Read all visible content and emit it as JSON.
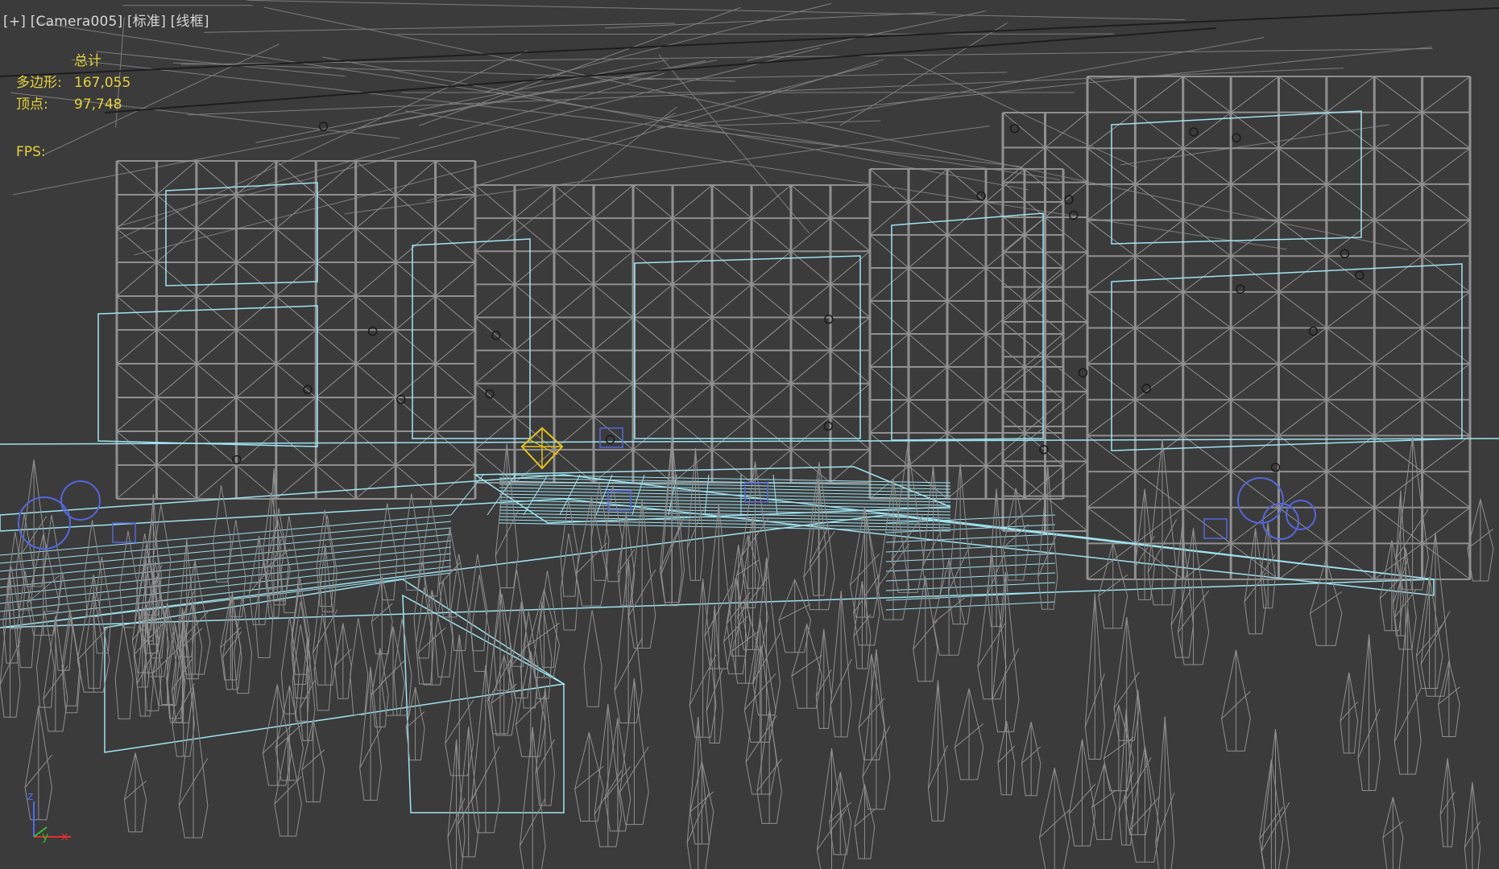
{
  "viewport_label": {
    "menu": "[+]",
    "camera": "[Camera005]",
    "shading": "[标准]",
    "mode": "[线框]"
  },
  "stats": {
    "header": "总计",
    "polygons_label": "多边形:",
    "polygons_value": "167,055",
    "vertices_label": "顶点:",
    "vertices_value": "97,748",
    "fps_label": "FPS:"
  },
  "axis_gizmo": {
    "z": "z",
    "y": "y",
    "x": "x"
  },
  "colors": {
    "background": "#3b3b3b",
    "wire_gray": "#8f8f8f",
    "wire_selected": "#9fe4f2",
    "light_blue": "#5566dd",
    "camera_target": "#e6c21a",
    "stats_text": "#e6d23a"
  }
}
